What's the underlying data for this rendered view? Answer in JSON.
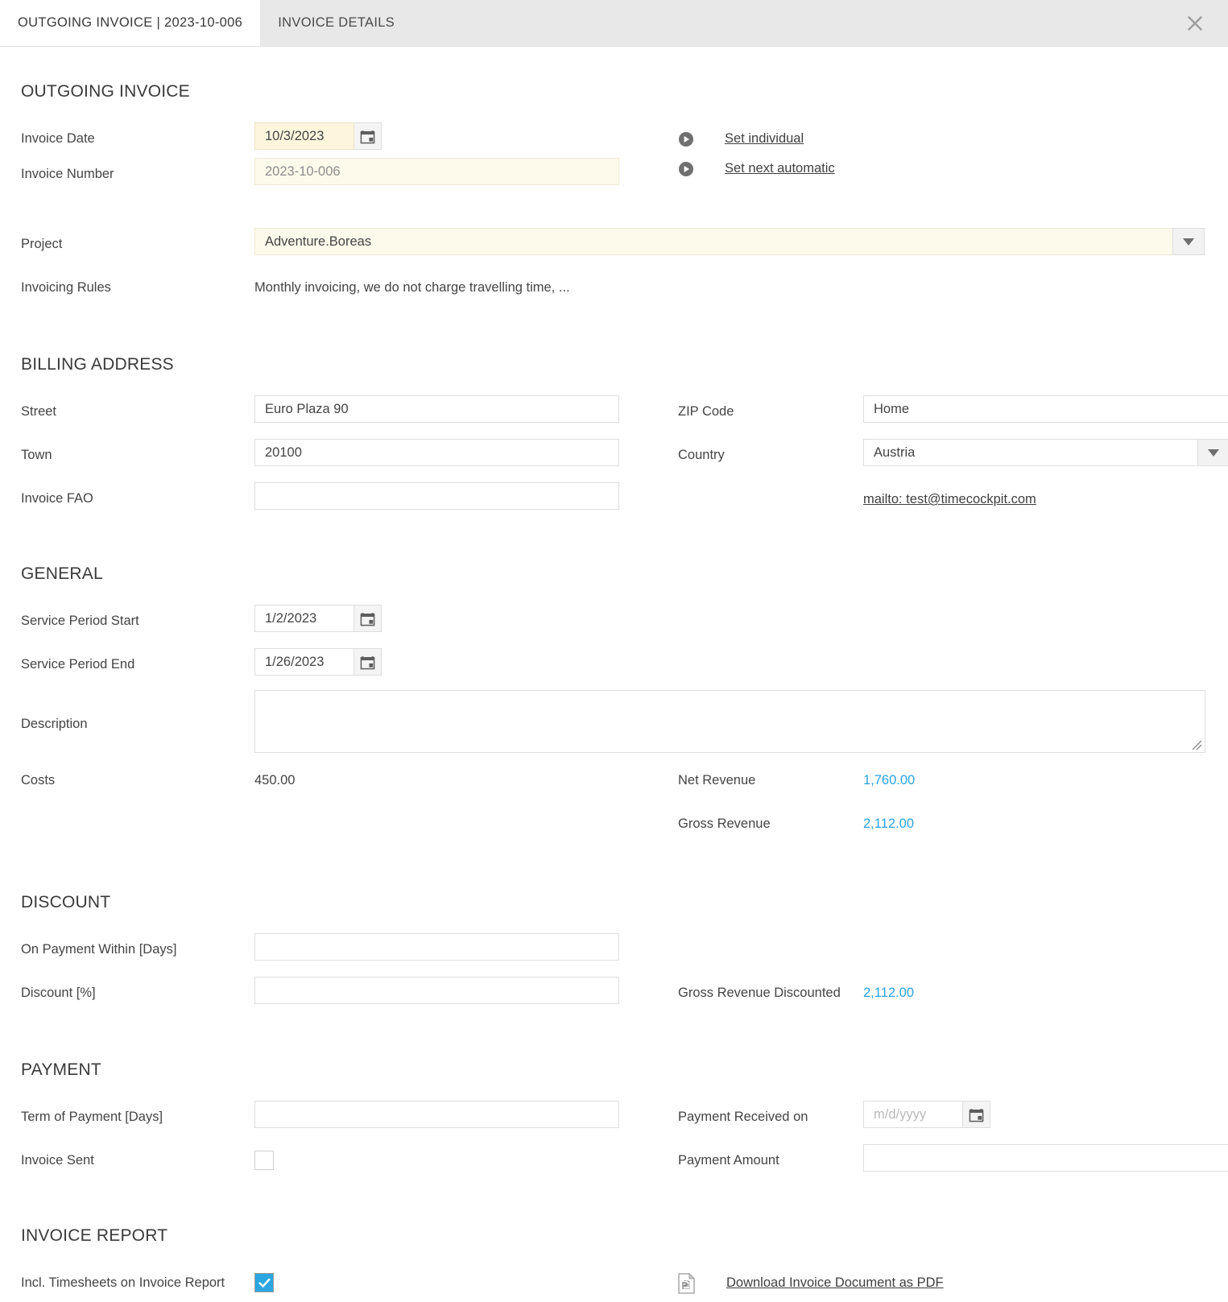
{
  "tabs": [
    {
      "label": "OUTGOING INVOICE | 2023-10-006",
      "active": true
    },
    {
      "label": "INVOICE DETAILS",
      "active": false
    }
  ],
  "close_icon": "close-icon",
  "sections": {
    "outgoing": {
      "title": "OUTGOING INVOICE",
      "invoice_date_label": "Invoice Date",
      "invoice_date_value": "10/3/2023",
      "invoice_number_label": "Invoice Number",
      "invoice_number_value": "2023-10-006",
      "set_individual_label": "Set individual",
      "set_next_automatic_label": "Set next automatic",
      "project_label": "Project",
      "project_value": "Adventure.Boreas",
      "invoicing_rules_label": "Invoicing Rules",
      "invoicing_rules_value": "Monthly invoicing, we do not charge travelling time, ..."
    },
    "billing": {
      "title": "BILLING ADDRESS",
      "street_label": "Street",
      "street_value": "Euro Plaza 90",
      "town_label": "Town",
      "town_value": "20100",
      "invoice_fao_label": "Invoice FAO",
      "invoice_fao_value": "",
      "zip_label": "ZIP Code",
      "zip_value": "Home",
      "country_label": "Country",
      "country_value": "Austria",
      "mailto_link": "mailto: test@timecockpit.com"
    },
    "general": {
      "title": "GENERAL",
      "service_start_label": "Service Period Start",
      "service_start_value": "1/2/2023",
      "service_end_label": "Service Period End",
      "service_end_value": "1/26/2023",
      "description_label": "Description",
      "description_value": "",
      "costs_label": "Costs",
      "costs_value": "450.00",
      "net_revenue_label": "Net Revenue",
      "net_revenue_value": "1,760.00",
      "gross_revenue_label": "Gross Revenue",
      "gross_revenue_value": "2,112.00"
    },
    "discount": {
      "title": "DISCOUNT",
      "on_payment_within_label": "On Payment Within [Days]",
      "on_payment_within_value": "",
      "discount_pct_label": "Discount [%]",
      "discount_pct_value": "",
      "gross_discounted_label": "Gross Revenue Discounted",
      "gross_discounted_value": "2,112.00"
    },
    "payment": {
      "title": "PAYMENT",
      "term_label": "Term of Payment [Days]",
      "term_value": "",
      "invoice_sent_label": "Invoice Sent",
      "invoice_sent_checked": false,
      "received_on_label": "Payment Received on",
      "received_on_value": "",
      "received_on_placeholder": "m/d/yyyy",
      "payment_amount_label": "Payment Amount",
      "payment_amount_value": ""
    },
    "report": {
      "title": "INVOICE REPORT",
      "incl_timesheets_label": "Incl. Timesheets on Invoice Report",
      "incl_timesheets_checked": true,
      "download_pdf_label": "Download Invoice Document as PDF"
    }
  },
  "colors": {
    "accent_blue": "#29a3e0",
    "highlight_yellow": "#fdf6dd",
    "tabbar_gray": "#e8e8e8"
  }
}
